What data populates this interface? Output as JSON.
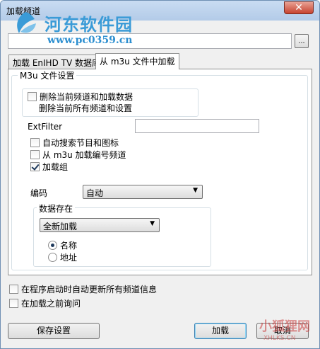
{
  "window": {
    "title": "加载频道",
    "close_symbol": "✕"
  },
  "watermark": {
    "site_name": "河东软件园",
    "url": "www.pc0359.cn",
    "corner_text": "小狐狸网",
    "corner_sub": "XHLKS.CN"
  },
  "path_input": {
    "value": ""
  },
  "browse_button": {
    "label": "..."
  },
  "tabs": [
    {
      "label": "加载 EnIHD TV 数据库",
      "active": false
    },
    {
      "label": "从 m3u 文件中加载",
      "active": true
    }
  ],
  "m3u_group": {
    "title": "M3u 文件设置",
    "delete_current": {
      "label": "删除当前频道和加载数据",
      "note": "删除当前所有频道和设置",
      "checked": false
    },
    "extfilter": {
      "label": "ExtFilter",
      "value": ""
    },
    "auto_search": {
      "label": "自动搜索节目和图标",
      "checked": false
    },
    "load_numbering": {
      "label": "从 m3u 加载编号频道",
      "checked": false
    },
    "load_groups": {
      "label": "加载组",
      "checked": true
    },
    "encoding": {
      "label": "编码",
      "selected": "自动"
    },
    "data_exists": {
      "title": "数据存在",
      "selected": "全新加载",
      "radio_name": {
        "label": "名称",
        "checked": true
      },
      "radio_address": {
        "label": "地址",
        "checked": false
      }
    }
  },
  "auto_update": {
    "label": "在程序启动时自动更新所有频道信息",
    "checked": false
  },
  "ask_before": {
    "label": "在加载之前询问",
    "checked": false
  },
  "buttons": {
    "save": "保存设置",
    "load": "加载",
    "cancel": "取消"
  }
}
